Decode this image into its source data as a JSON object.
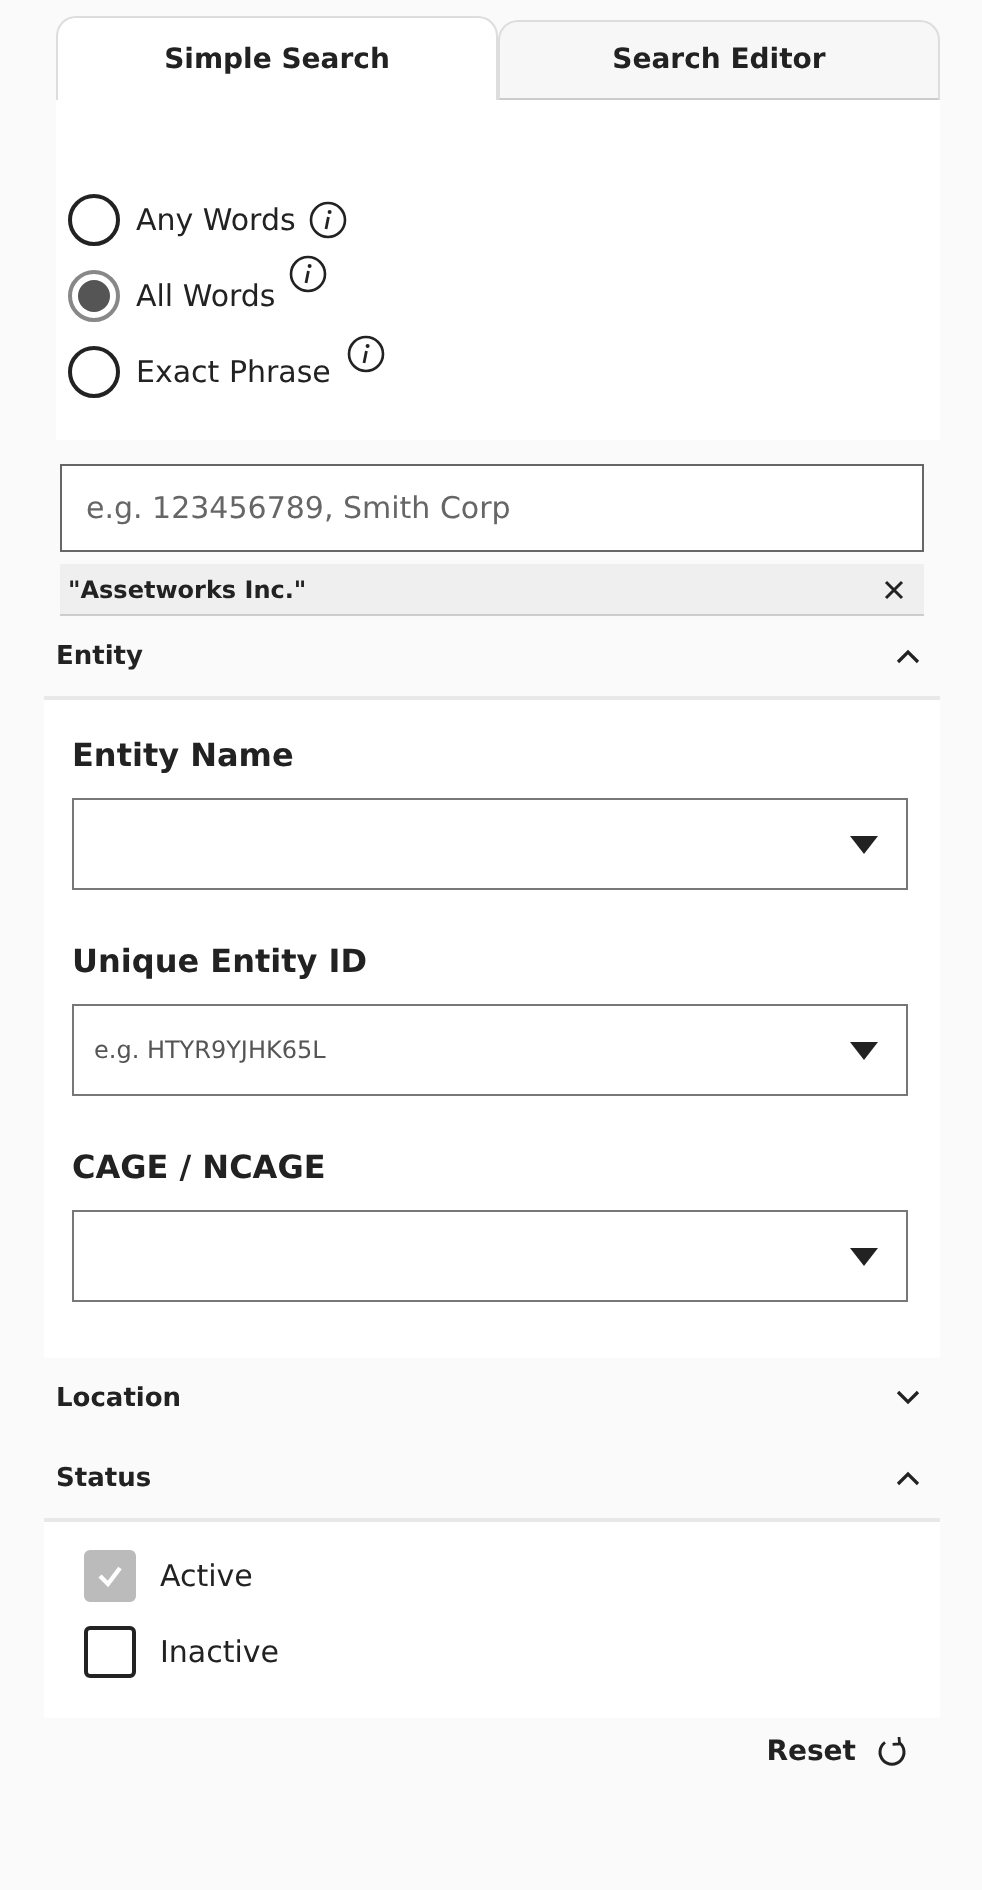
{
  "tabs": [
    {
      "label": "Simple Search",
      "selected": true
    },
    {
      "label": "Search Editor",
      "selected": false
    }
  ],
  "match_options": [
    {
      "label": "Any Words",
      "selected": false
    },
    {
      "label": "All Words",
      "selected": true
    },
    {
      "label": "Exact Phrase",
      "selected": false
    }
  ],
  "search": {
    "placeholder": "e.g. 123456789, Smith Corp"
  },
  "chips": [
    {
      "label": "\"Assetworks Inc.\""
    }
  ],
  "sections": [
    {
      "title": "Entity",
      "expanded": true,
      "kind": "fields",
      "fields": [
        {
          "label": "Entity Name"
        },
        {
          "label": "Unique Entity ID",
          "placeholder": "e.g. HTYR9YJHK65L"
        },
        {
          "label": "CAGE / NCAGE"
        }
      ]
    },
    {
      "title": "Location",
      "expanded": false
    },
    {
      "title": "Status",
      "expanded": true,
      "kind": "checks",
      "options": [
        {
          "label": "Active",
          "checked": true,
          "disabled": true
        },
        {
          "label": "Inactive",
          "checked": false,
          "disabled": false
        }
      ]
    }
  ],
  "reset": {
    "label": "Reset"
  }
}
